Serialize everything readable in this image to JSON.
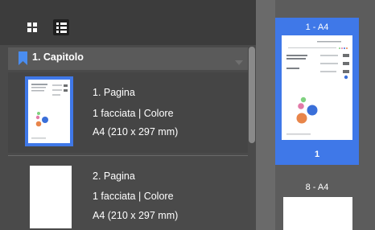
{
  "toolbar": {
    "grid_view_icon": "grid-icon",
    "list_view_icon": "list-icon"
  },
  "chapter": {
    "label": "1.  Capitolo",
    "icon": "bookmark-icon",
    "accent": "#3f78e8"
  },
  "pages": [
    {
      "title": "1. Pagina",
      "sides": "1 facciata | Colore",
      "size": "A4 (210 x 297 mm)",
      "selected": true
    },
    {
      "title": "2. Pagina",
      "sides": "1 facciata | Colore",
      "size": "A4 (210 x 297 mm)",
      "selected": false
    }
  ],
  "preview": {
    "card1_title": "1 - A4",
    "card1_number": "1",
    "card2_title": "8 - A4"
  },
  "colors": {
    "selection": "#3f78e8",
    "panel_dark": "#3c3c3c",
    "panel": "#4a4a4a"
  }
}
